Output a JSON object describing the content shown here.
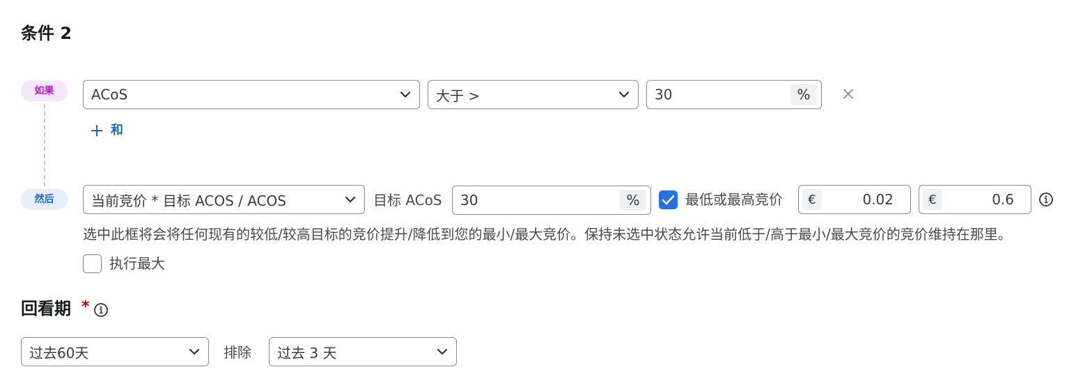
{
  "condition": {
    "title": "条件 2",
    "if_label": "如果",
    "then_label": "然后",
    "metric_select": {
      "value": "ACoS"
    },
    "operator_select": {
      "value": "大于 >"
    },
    "threshold_input": {
      "value": "30",
      "suffix": "%"
    },
    "add_and_label": "和",
    "action_select": {
      "value": "当前竞价 * 目标 ACOS / ACOS"
    },
    "target_acos_label": "目标 ACoS",
    "target_acos_input": {
      "value": "30",
      "suffix": "%"
    },
    "minmax_checkbox": {
      "label": "最低或最高竞价",
      "checked": true
    },
    "min_bid": {
      "prefix": "€",
      "value": "0.02"
    },
    "max_bid": {
      "prefix": "€",
      "value": "0.6"
    },
    "description": "选中此框将会将任何现有的较低/较高目标的竞价提升/降低到您的最小/最大竞价。保持未选中状态允许当前低于/高于最小/最大竞价的竞价维持在那里。",
    "enforce_max_checkbox": {
      "label": "执行最大",
      "checked": false
    }
  },
  "lookback": {
    "title": "回看期",
    "required_mark": "*",
    "period_select": {
      "value": "过去60天"
    },
    "exclude_label": "排除",
    "exclude_select": {
      "value": "过去 3 天"
    }
  },
  "colors": {
    "accent": "#2a6fe0",
    "if_pill_bg": "#f6e6fb",
    "then_pill_bg": "#e4effb",
    "required": "#c40000"
  },
  "icons": [
    "chevron-down-icon",
    "close-icon",
    "plus-icon",
    "check-icon",
    "info-icon"
  ]
}
